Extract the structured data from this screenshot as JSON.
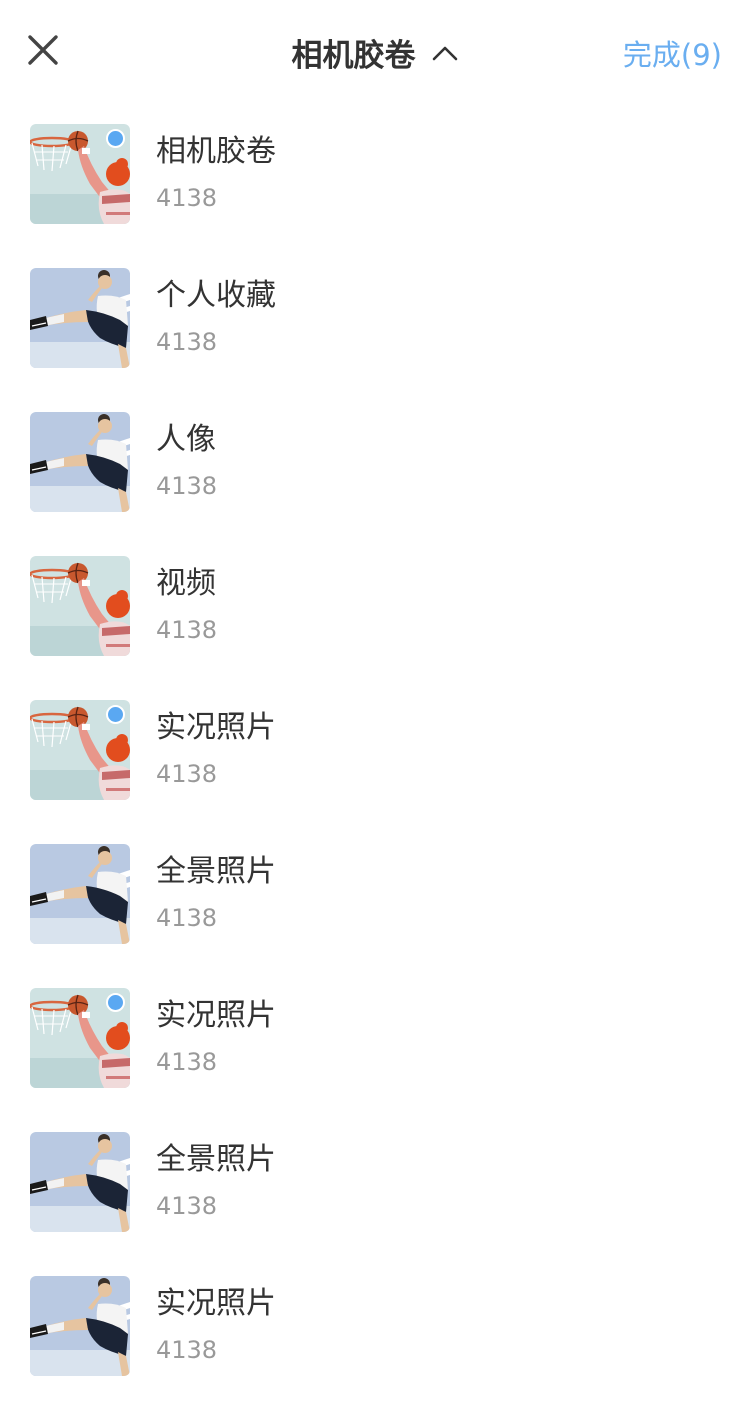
{
  "header": {
    "title": "相机胶卷",
    "done_label": "完成(9)"
  },
  "albums": [
    {
      "name": "相机胶卷",
      "count": "4138",
      "selected": true,
      "thumb": "dunk"
    },
    {
      "name": "个人收藏",
      "count": "4138",
      "selected": false,
      "thumb": "kick"
    },
    {
      "name": "人像",
      "count": "4138",
      "selected": false,
      "thumb": "kick"
    },
    {
      "name": "视频",
      "count": "4138",
      "selected": false,
      "thumb": "dunk"
    },
    {
      "name": "实况照片",
      "count": "4138",
      "selected": true,
      "thumb": "dunk"
    },
    {
      "name": "全景照片",
      "count": "4138",
      "selected": false,
      "thumb": "kick"
    },
    {
      "name": "实况照片",
      "count": "4138",
      "selected": true,
      "thumb": "dunk"
    },
    {
      "name": "全景照片",
      "count": "4138",
      "selected": false,
      "thumb": "kick"
    },
    {
      "name": "实况照片",
      "count": "4138",
      "selected": false,
      "thumb": "kick"
    }
  ],
  "colors": {
    "accent": "#6aaef0",
    "selected_dot": "#5aa8f2",
    "text_primary": "#333333",
    "text_secondary": "#999999"
  },
  "icons": {
    "close": "close-icon",
    "dropdown": "chevron-up-icon",
    "selected": "selected-dot-icon"
  }
}
